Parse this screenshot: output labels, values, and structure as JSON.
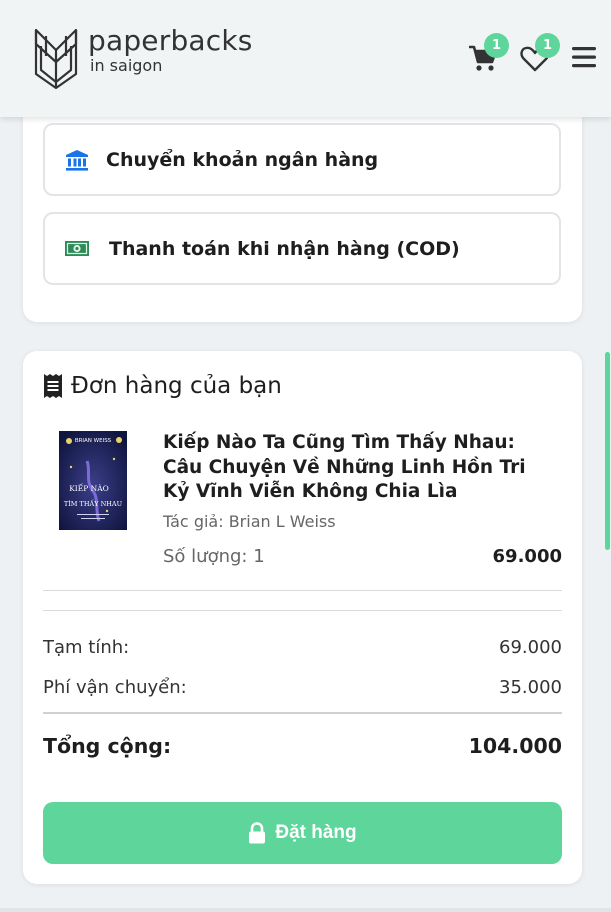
{
  "brand": {
    "name": "paperbacks",
    "tagline": "in saigon"
  },
  "header": {
    "cart_count": "1",
    "wishlist_count": "1"
  },
  "payment": {
    "options": [
      {
        "label": "Chuyển khoản ngân hàng",
        "icon": "bank-icon"
      },
      {
        "label": "Thanh toán khi nhận hàng (COD)",
        "icon": "cash-icon"
      }
    ]
  },
  "order": {
    "title": "Đơn hàng của bạn",
    "item": {
      "title": "Kiếp Nào Ta Cũng Tìm Thấy Nhau: Câu Chuyện Về Những Linh Hồn Tri Kỷ Vĩnh Viễn Không Chia Lìa",
      "author": "Tác giả: Brian L Weiss",
      "quantity": "Số lượng: 1",
      "price": "69.000",
      "cover": {
        "author": "BRIAN WEISS",
        "title_top": "KIẾP NÀO",
        "title_bottom": "TÌM THẤY NHAU"
      }
    },
    "subtotal_label": "Tạm tính:",
    "subtotal": "69.000",
    "shipping_label": "Phí vận chuyển:",
    "shipping": "35.000",
    "total_label": "Tổng cộng:",
    "total": "104.000",
    "submit_label": "Đặt hàng"
  },
  "colors": {
    "accent": "#5ed59a",
    "bank_icon": "#1a73e8",
    "cash_icon": "#2e8b57"
  }
}
